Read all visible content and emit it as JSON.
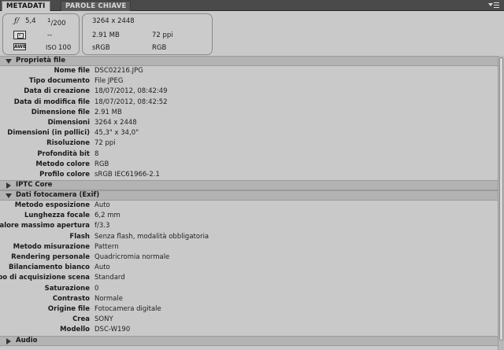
{
  "tabs": [
    {
      "label": "METADATI"
    },
    {
      "label": "PAROLE CHIAVE"
    }
  ],
  "camera_info": {
    "fnumber": "5,4",
    "shutter_num": "1",
    "shutter_den": "200",
    "metering_value": "--",
    "iso_label": "ISO",
    "iso_value": "100",
    "wb_label": "AWB",
    "dimensions": "3264 x 2448",
    "file_size": "2.91 MB",
    "resolution": "72 ppi",
    "color_profile": "sRGB",
    "color_mode": "RGB"
  },
  "sections": {
    "file_props": {
      "title": "Proprietà file",
      "rows": [
        {
          "key": "Nome file",
          "value": "DSC02216.JPG"
        },
        {
          "key": "Tipo documento",
          "value": "File JPEG"
        },
        {
          "key": "Data di creazione",
          "value": "18/07/2012, 08:42:49"
        },
        {
          "key": "Data di modifica file",
          "value": "18/07/2012, 08:42:52"
        },
        {
          "key": "Dimensione file",
          "value": "2.91 MB"
        },
        {
          "key": "Dimensioni",
          "value": "3264 x 2448"
        },
        {
          "key": "Dimensioni (in pollici)",
          "value": "45,3\" x 34,0\""
        },
        {
          "key": "Risoluzione",
          "value": "72 ppi"
        },
        {
          "key": "Profondità bit",
          "value": "8"
        },
        {
          "key": "Metodo colore",
          "value": "RGB"
        },
        {
          "key": "Profilo colore",
          "value": "sRGB IEC61966-2.1"
        }
      ]
    },
    "iptc": {
      "title": "IPTC Core"
    },
    "exif": {
      "title": "Dati fotocamera (Exif)",
      "rows": [
        {
          "key": "Metodo esposizione",
          "value": "Auto"
        },
        {
          "key": "Lunghezza focale",
          "value": "6,2 mm"
        },
        {
          "key": "Valore massimo apertura",
          "value": "f/3.3"
        },
        {
          "key": "Flash",
          "value": "Senza flash, modalità obbligatoria"
        },
        {
          "key": "Metodo misurazione",
          "value": "Pattern"
        },
        {
          "key": "Rendering personale",
          "value": "Quadricromia normale"
        },
        {
          "key": "Bilanciamento bianco",
          "value": "Auto"
        },
        {
          "key": "Tipo di acquisizione scena",
          "value": "Standard"
        },
        {
          "key": "Saturazione",
          "value": "0"
        },
        {
          "key": "Contrasto",
          "value": "Normale"
        },
        {
          "key": "Origine file",
          "value": "Fotocamera digitale"
        },
        {
          "key": "Crea",
          "value": "SONY"
        },
        {
          "key": "Modello",
          "value": "DSC-W190"
        }
      ]
    },
    "audio": {
      "title": "Audio"
    }
  }
}
